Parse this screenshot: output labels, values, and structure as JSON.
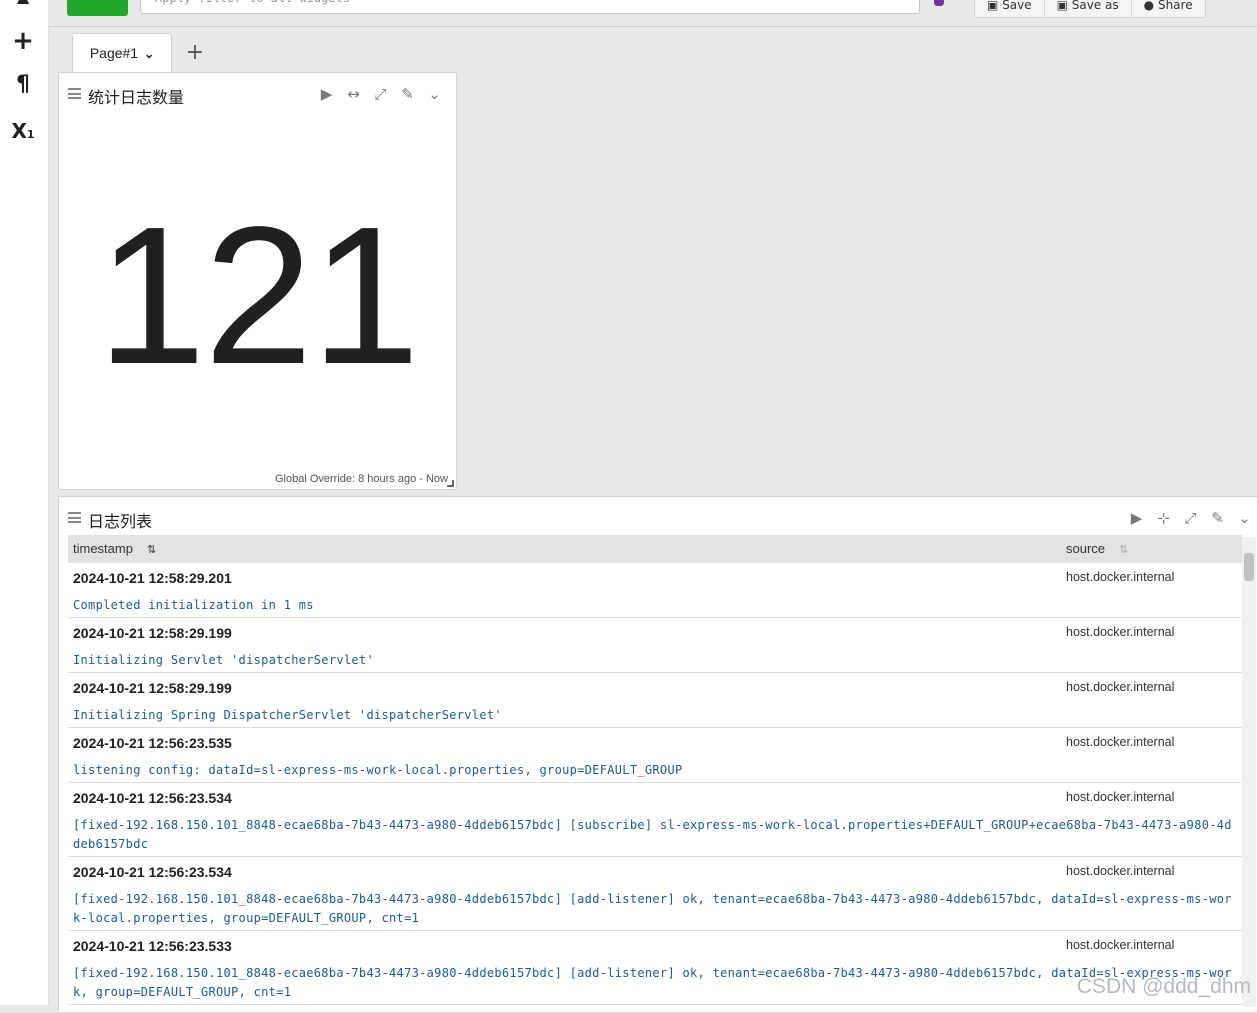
{
  "toolbar": {
    "filter_placeholder": "Apply filter to all widgets",
    "save_label": "Save",
    "save_as_label": "Save as",
    "share_label": "Share",
    "more_label": "⋯"
  },
  "rail": {
    "icons": [
      "plus-icon",
      "pilcrow-icon",
      "subscript-icon"
    ]
  },
  "tabs": [
    {
      "label": "Page#1"
    }
  ],
  "widgets": {
    "count": {
      "title": "统计日志数量",
      "value": "121",
      "footer": "Global Override: 8 hours ago - Now"
    },
    "log_list": {
      "title": "日志列表",
      "columns": {
        "timestamp": "timestamp",
        "source": "source"
      },
      "rows": [
        {
          "time": "2024-10-21 12:58:29.201",
          "source": "host.docker.internal",
          "message": "Completed initialization in 1 ms"
        },
        {
          "time": "2024-10-21 12:58:29.199",
          "source": "host.docker.internal",
          "message": "Initializing Servlet 'dispatcherServlet'"
        },
        {
          "time": "2024-10-21 12:58:29.199",
          "source": "host.docker.internal",
          "message": "Initializing Spring DispatcherServlet 'dispatcherServlet'"
        },
        {
          "time": "2024-10-21 12:56:23.535",
          "source": "host.docker.internal",
          "message": "listening config: dataId=sl-express-ms-work-local.properties, group=DEFAULT_GROUP"
        },
        {
          "time": "2024-10-21 12:56:23.534",
          "source": "host.docker.internal",
          "message": "[fixed-192.168.150.101_8848-ecae68ba-7b43-4473-a980-4ddeb6157bdc] [subscribe] sl-express-ms-work-local.properties+DEFAULT_GROUP+ecae68ba-7b43-4473-a980-4ddeb6157bdc"
        },
        {
          "time": "2024-10-21 12:56:23.534",
          "source": "host.docker.internal",
          "message": "[fixed-192.168.150.101_8848-ecae68ba-7b43-4473-a980-4ddeb6157bdc] [add-listener] ok, tenant=ecae68ba-7b43-4473-a980-4ddeb6157bdc, dataId=sl-express-ms-work-local.properties, group=DEFAULT_GROUP, cnt=1"
        },
        {
          "time": "2024-10-21 12:56:23.533",
          "source": "host.docker.internal",
          "message": "[fixed-192.168.150.101_8848-ecae68ba-7b43-4473-a980-4ddeb6157bdc] [add-listener] ok, tenant=ecae68ba-7b43-4473-a980-4ddeb6157bdc, dataId=sl-express-ms-work, group=DEFAULT_GROUP, cnt=1"
        }
      ]
    }
  },
  "watermark": "CSDN @ddd_dhm",
  "colors": {
    "accent_green": "#21a62a",
    "message_blue": "#1a5ba0",
    "background": "#e8e8e8"
  }
}
